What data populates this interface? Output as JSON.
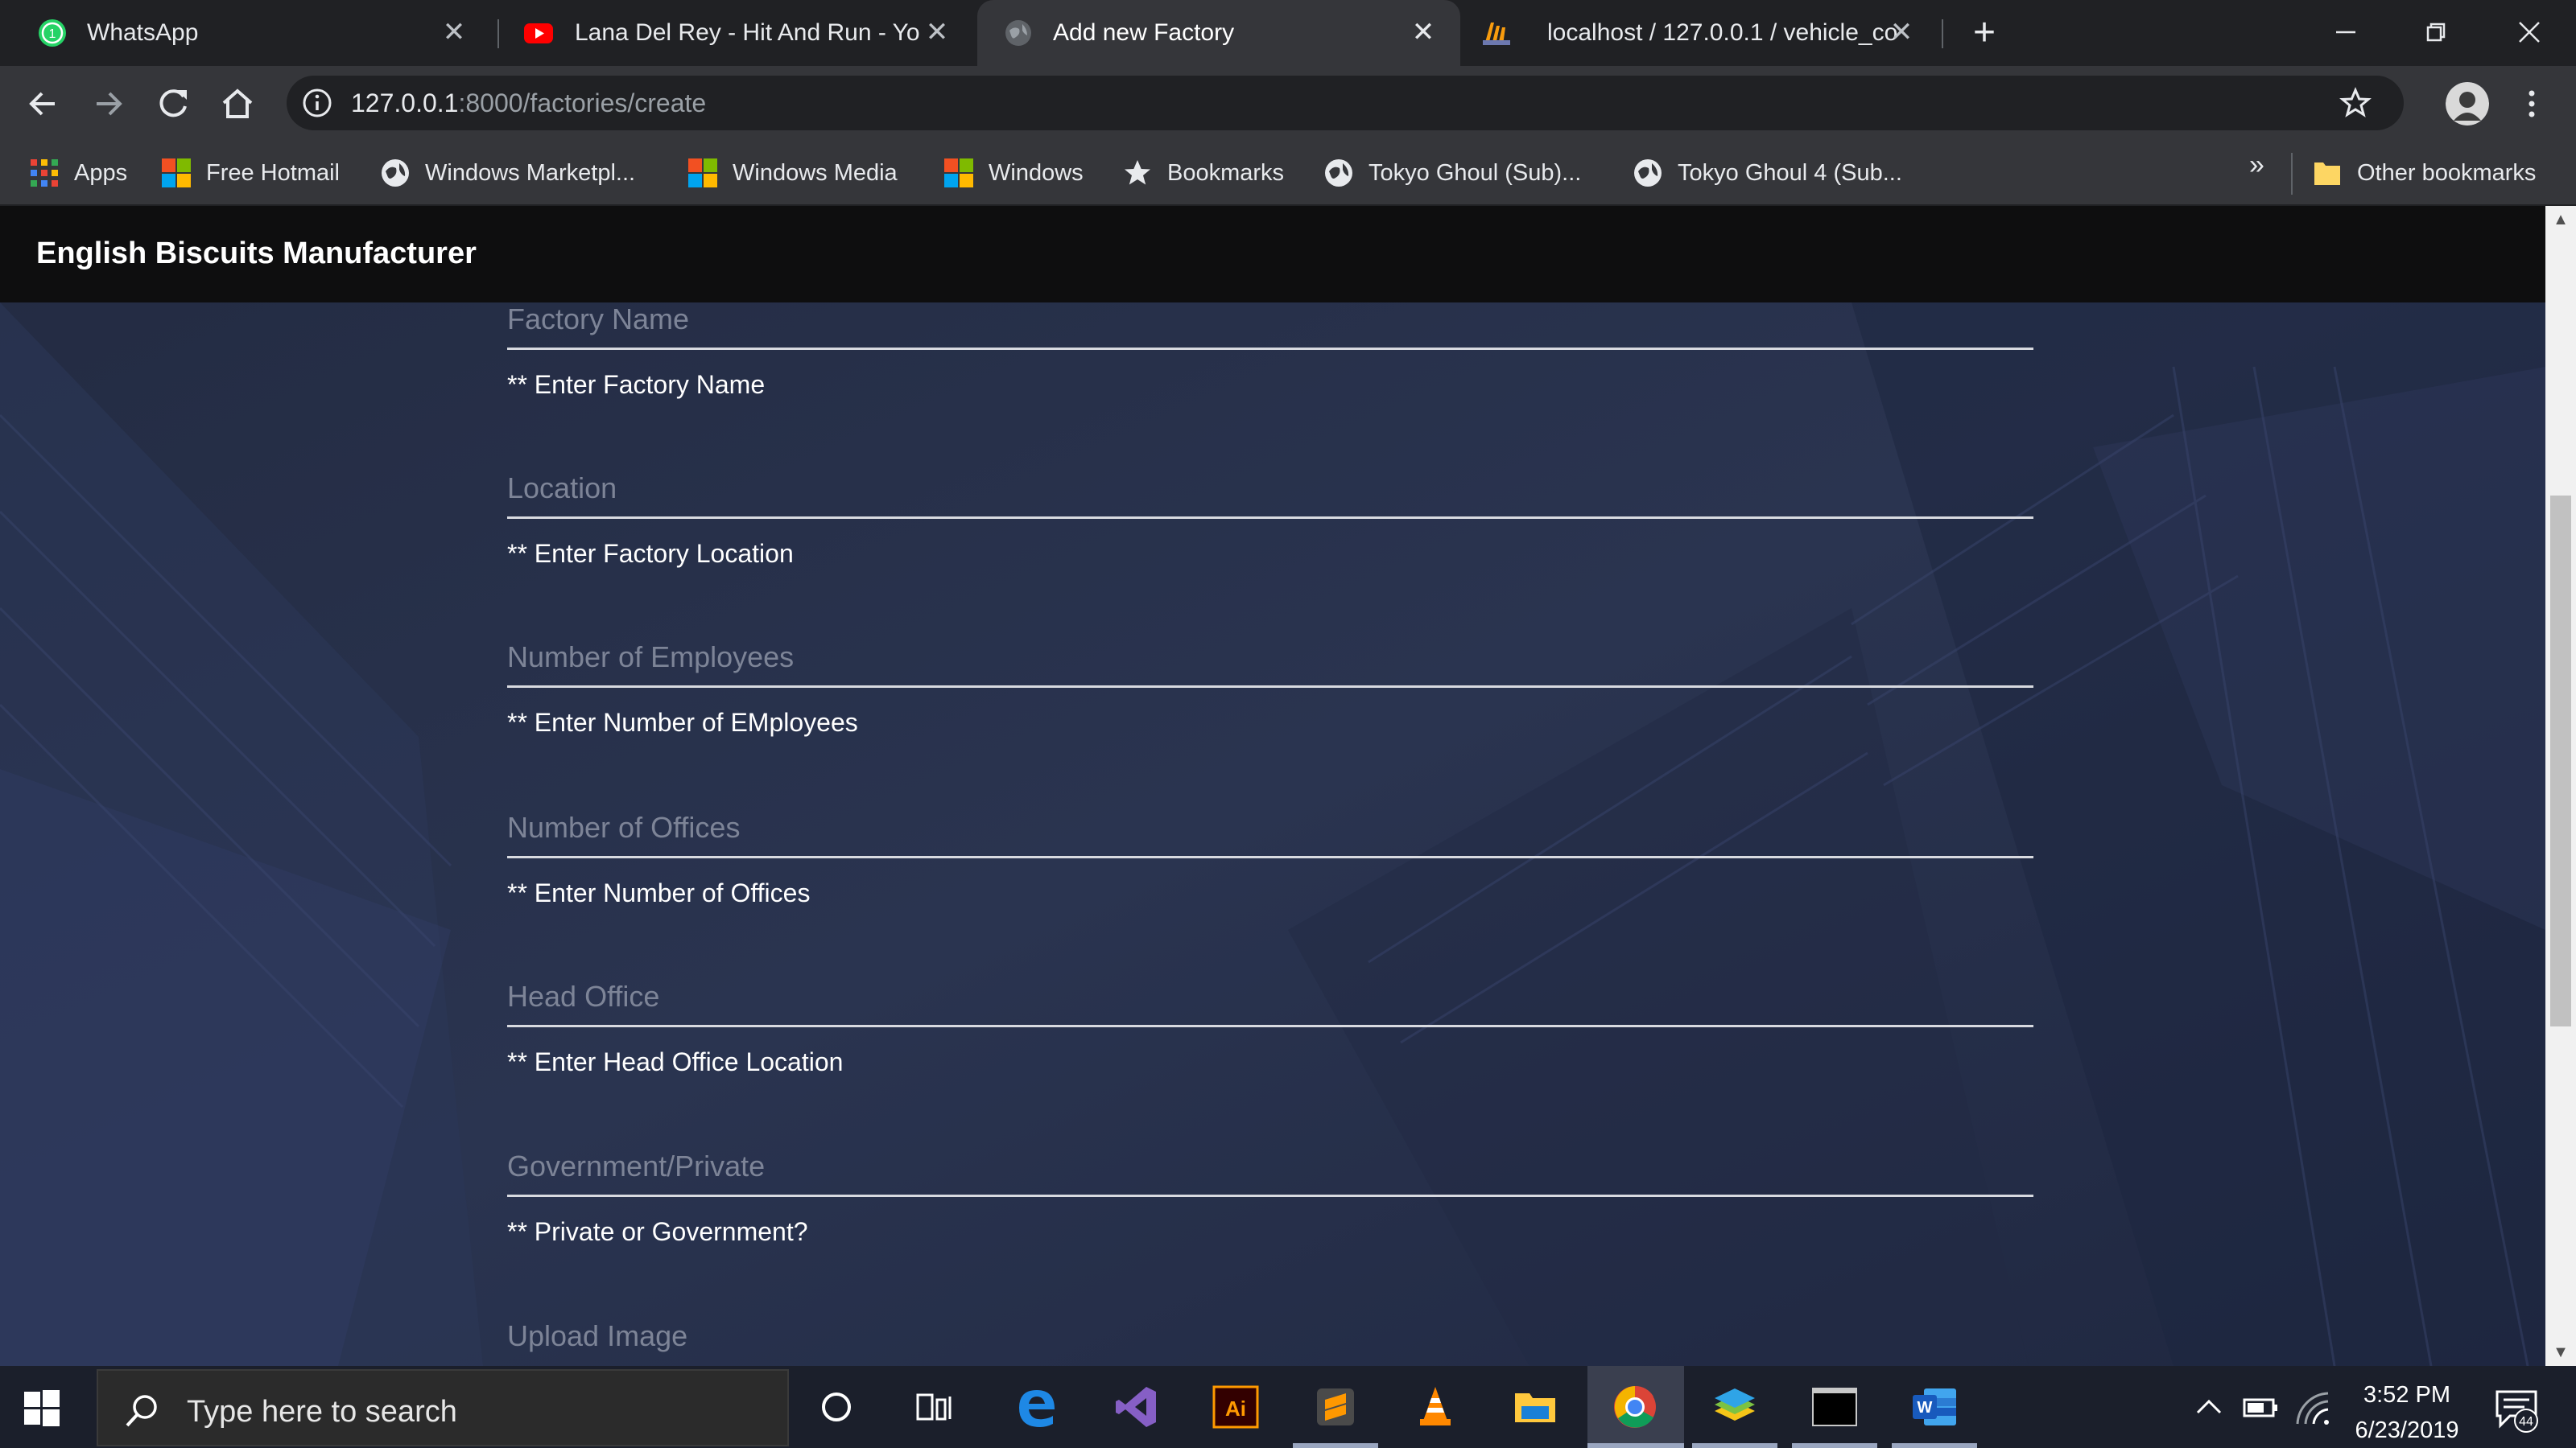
{
  "browser": {
    "tabs": [
      {
        "title": "WhatsApp",
        "icon": "whatsapp-icon",
        "active": false
      },
      {
        "title": "Lana Del Rey - Hit And Run - You",
        "icon": "youtube-icon",
        "active": false
      },
      {
        "title": "Add new Factory",
        "icon": "globe-icon",
        "active": true
      },
      {
        "title": "localhost / 127.0.0.1 / vehicle_co",
        "icon": "phpmyadmin-icon",
        "active": false
      }
    ],
    "new_tab": "+",
    "url_host": "127.0.0.1",
    "url_rest": ":8000/factories/create",
    "bookmarks": [
      {
        "label": "Apps",
        "icon": "apps-grid-icon"
      },
      {
        "label": "Free Hotmail",
        "icon": "windows-logo-icon"
      },
      {
        "label": "Windows Marketpl...",
        "icon": "globe-icon"
      },
      {
        "label": "Windows Media",
        "icon": "windows-logo-icon"
      },
      {
        "label": "Windows",
        "icon": "windows-logo-icon"
      },
      {
        "label": "Bookmarks",
        "icon": "star-icon"
      },
      {
        "label": "Tokyo Ghoul (Sub)...",
        "icon": "globe-icon"
      },
      {
        "label": "Tokyo Ghoul 4 (Sub...",
        "icon": "globe-icon"
      }
    ],
    "bookmarks_more": "»",
    "other_bookmarks": "Other bookmarks"
  },
  "page": {
    "brand": "English Biscuits Manufacturer",
    "fields": [
      {
        "label": "Factory Name",
        "hint": "** Enter Factory Name"
      },
      {
        "label": "Location",
        "hint": "** Enter Factory Location"
      },
      {
        "label": "Number of Employees",
        "hint": "** Enter Number of EMployees"
      },
      {
        "label": "Number of Offices",
        "hint": "** Enter Number of Offices"
      },
      {
        "label": "Head Office",
        "hint": "** Enter Head Office Location"
      },
      {
        "label": "Government/Private",
        "hint": "** Private or Government?"
      },
      {
        "label": "Upload Image",
        "hint": ""
      }
    ]
  },
  "taskbar": {
    "search_placeholder": "Type here to search",
    "time": "3:52 PM",
    "date": "6/23/2019",
    "notification_count": "44",
    "whatsapp_badge": "1"
  },
  "colors": {
    "page_bg": "#27304a",
    "navbar_bg": "#0e0e0f",
    "label_color": "#7d8497",
    "hint_color": "#ffffff"
  }
}
